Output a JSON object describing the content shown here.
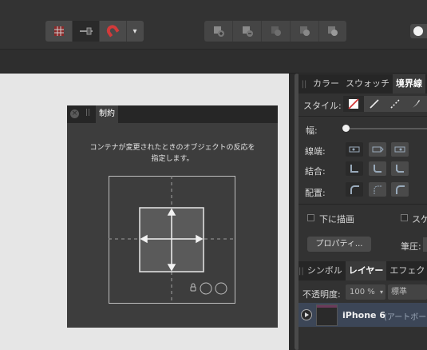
{
  "toolbar": {
    "snapping_icons": [
      "grid-snap-icon",
      "baseline-snap-icon",
      "magnet-icon"
    ],
    "snapping_dropdown": "▾",
    "boolean_icons": [
      "add-icon",
      "subtract-icon",
      "intersect-icon",
      "xor-icon",
      "divide-icon"
    ]
  },
  "panel_top": {
    "tabs": [
      "カラー",
      "スウォッチ",
      "境界線"
    ],
    "selected_tab": "境界線",
    "style_label": "スタイル:",
    "width_label": "幅:",
    "cap_label": "線端:",
    "join_label": "結合:",
    "align_label": "配置:",
    "draw_behind_label": "下に描画",
    "scale_label": "スケ",
    "properties_button": "プロパティ...",
    "pressure_label": "筆圧:"
  },
  "panel_bottom": {
    "tabs": [
      "シンボル",
      "レイヤー",
      "エフェク"
    ],
    "selected_tab": "レイヤー",
    "opacity_label": "不透明度:",
    "opacity_value": "100 %",
    "blend_value": "標準",
    "layer_name": "iPhone 6",
    "layer_type": "(アートボー"
  },
  "dialog": {
    "tab_label": "制約",
    "description_line1": "コンテナが変更されたときのオブジェクトの反応を",
    "description_line2": "指定します。"
  },
  "colors": {
    "canvas": "#e6e6e6",
    "accent_red": "#d23a3a",
    "layer_selected": "#3c4657"
  }
}
